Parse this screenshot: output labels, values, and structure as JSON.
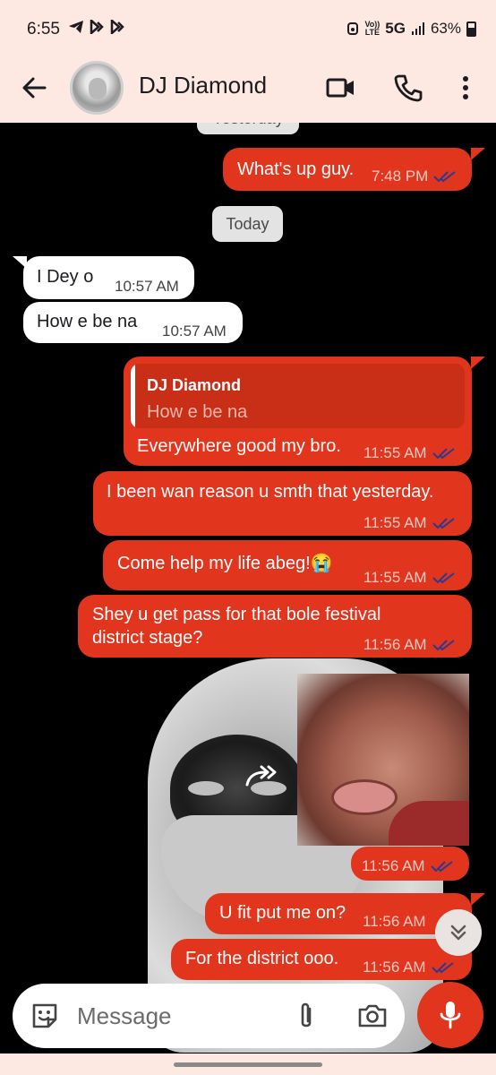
{
  "status_bar": {
    "time": "6:55",
    "left_icons": [
      "telegram-icon",
      "b-app-icon",
      "b-app-icon"
    ],
    "network": "5G",
    "volte_top": "Vo))",
    "volte_bottom": "LTE",
    "battery": "63%"
  },
  "header": {
    "contact_name": "DJ Diamond",
    "icons": [
      "back-arrow-icon",
      "video-call-icon",
      "phone-icon",
      "more-vert-icon"
    ]
  },
  "chat": {
    "date_yesterday": "Yesterday",
    "date_today": "Today",
    "messages": [
      {
        "text": "What's up guy.",
        "time": "7:48 PM",
        "direction": "out"
      },
      {
        "text": "I Dey o",
        "time": "10:57 AM",
        "direction": "in"
      },
      {
        "text": "How e be na",
        "time": "10:57 AM",
        "direction": "in"
      },
      {
        "text": "Everywhere good my bro.",
        "time": "11:55 AM",
        "direction": "out",
        "quote_name": "DJ Diamond",
        "quote_text": "How e be na"
      },
      {
        "text": "I been wan reason u smth that yesterday.",
        "time": "11:55 AM",
        "direction": "out"
      },
      {
        "text": "Come help my life abeg!😭",
        "time": "11:55 AM",
        "direction": "out"
      },
      {
        "text_line1": "Shey u get pass for that bole festival",
        "text_line2": "district stage?",
        "time": "11:56 AM",
        "direction": "out"
      },
      {
        "type": "image",
        "time": "11:56 AM",
        "direction": "out"
      },
      {
        "text": "U fit put me on?",
        "time": "11:56 AM",
        "direction": "out"
      },
      {
        "text": "For the district ooo.",
        "time": "11:56 AM",
        "direction": "out"
      }
    ]
  },
  "composer": {
    "placeholder": "Message",
    "icons": [
      "sticker-icon",
      "attach-icon",
      "camera-icon",
      "mic-icon"
    ]
  },
  "colors": {
    "accent": "#e1351d",
    "header_bg": "#fde9e2",
    "chat_bg": "#000000"
  }
}
